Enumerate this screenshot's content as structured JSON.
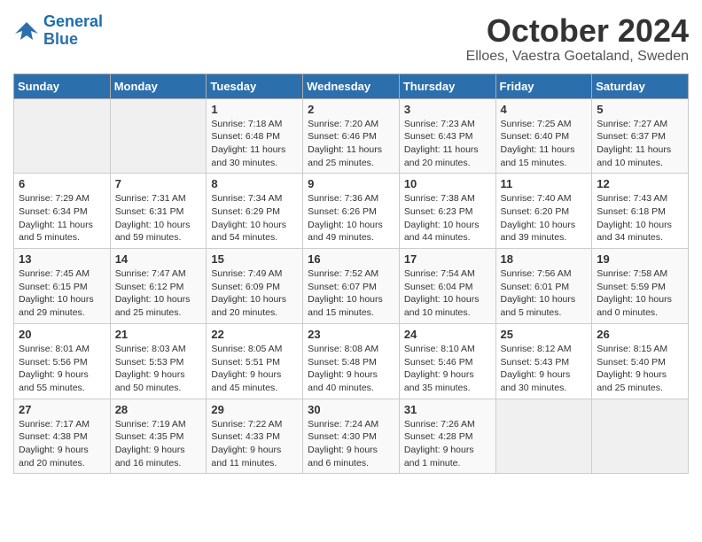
{
  "header": {
    "logo_line1": "General",
    "logo_line2": "Blue",
    "month_title": "October 2024",
    "subtitle": "Elloes, Vaestra Goetaland, Sweden"
  },
  "days_of_week": [
    "Sunday",
    "Monday",
    "Tuesday",
    "Wednesday",
    "Thursday",
    "Friday",
    "Saturday"
  ],
  "weeks": [
    [
      {
        "day": "",
        "info": ""
      },
      {
        "day": "",
        "info": ""
      },
      {
        "day": "1",
        "info": "Sunrise: 7:18 AM\nSunset: 6:48 PM\nDaylight: 11 hours\nand 30 minutes."
      },
      {
        "day": "2",
        "info": "Sunrise: 7:20 AM\nSunset: 6:46 PM\nDaylight: 11 hours\nand 25 minutes."
      },
      {
        "day": "3",
        "info": "Sunrise: 7:23 AM\nSunset: 6:43 PM\nDaylight: 11 hours\nand 20 minutes."
      },
      {
        "day": "4",
        "info": "Sunrise: 7:25 AM\nSunset: 6:40 PM\nDaylight: 11 hours\nand 15 minutes."
      },
      {
        "day": "5",
        "info": "Sunrise: 7:27 AM\nSunset: 6:37 PM\nDaylight: 11 hours\nand 10 minutes."
      }
    ],
    [
      {
        "day": "6",
        "info": "Sunrise: 7:29 AM\nSunset: 6:34 PM\nDaylight: 11 hours\nand 5 minutes."
      },
      {
        "day": "7",
        "info": "Sunrise: 7:31 AM\nSunset: 6:31 PM\nDaylight: 10 hours\nand 59 minutes."
      },
      {
        "day": "8",
        "info": "Sunrise: 7:34 AM\nSunset: 6:29 PM\nDaylight: 10 hours\nand 54 minutes."
      },
      {
        "day": "9",
        "info": "Sunrise: 7:36 AM\nSunset: 6:26 PM\nDaylight: 10 hours\nand 49 minutes."
      },
      {
        "day": "10",
        "info": "Sunrise: 7:38 AM\nSunset: 6:23 PM\nDaylight: 10 hours\nand 44 minutes."
      },
      {
        "day": "11",
        "info": "Sunrise: 7:40 AM\nSunset: 6:20 PM\nDaylight: 10 hours\nand 39 minutes."
      },
      {
        "day": "12",
        "info": "Sunrise: 7:43 AM\nSunset: 6:18 PM\nDaylight: 10 hours\nand 34 minutes."
      }
    ],
    [
      {
        "day": "13",
        "info": "Sunrise: 7:45 AM\nSunset: 6:15 PM\nDaylight: 10 hours\nand 29 minutes."
      },
      {
        "day": "14",
        "info": "Sunrise: 7:47 AM\nSunset: 6:12 PM\nDaylight: 10 hours\nand 25 minutes."
      },
      {
        "day": "15",
        "info": "Sunrise: 7:49 AM\nSunset: 6:09 PM\nDaylight: 10 hours\nand 20 minutes."
      },
      {
        "day": "16",
        "info": "Sunrise: 7:52 AM\nSunset: 6:07 PM\nDaylight: 10 hours\nand 15 minutes."
      },
      {
        "day": "17",
        "info": "Sunrise: 7:54 AM\nSunset: 6:04 PM\nDaylight: 10 hours\nand 10 minutes."
      },
      {
        "day": "18",
        "info": "Sunrise: 7:56 AM\nSunset: 6:01 PM\nDaylight: 10 hours\nand 5 minutes."
      },
      {
        "day": "19",
        "info": "Sunrise: 7:58 AM\nSunset: 5:59 PM\nDaylight: 10 hours\nand 0 minutes."
      }
    ],
    [
      {
        "day": "20",
        "info": "Sunrise: 8:01 AM\nSunset: 5:56 PM\nDaylight: 9 hours\nand 55 minutes."
      },
      {
        "day": "21",
        "info": "Sunrise: 8:03 AM\nSunset: 5:53 PM\nDaylight: 9 hours\nand 50 minutes."
      },
      {
        "day": "22",
        "info": "Sunrise: 8:05 AM\nSunset: 5:51 PM\nDaylight: 9 hours\nand 45 minutes."
      },
      {
        "day": "23",
        "info": "Sunrise: 8:08 AM\nSunset: 5:48 PM\nDaylight: 9 hours\nand 40 minutes."
      },
      {
        "day": "24",
        "info": "Sunrise: 8:10 AM\nSunset: 5:46 PM\nDaylight: 9 hours\nand 35 minutes."
      },
      {
        "day": "25",
        "info": "Sunrise: 8:12 AM\nSunset: 5:43 PM\nDaylight: 9 hours\nand 30 minutes."
      },
      {
        "day": "26",
        "info": "Sunrise: 8:15 AM\nSunset: 5:40 PM\nDaylight: 9 hours\nand 25 minutes."
      }
    ],
    [
      {
        "day": "27",
        "info": "Sunrise: 7:17 AM\nSunset: 4:38 PM\nDaylight: 9 hours\nand 20 minutes."
      },
      {
        "day": "28",
        "info": "Sunrise: 7:19 AM\nSunset: 4:35 PM\nDaylight: 9 hours\nand 16 minutes."
      },
      {
        "day": "29",
        "info": "Sunrise: 7:22 AM\nSunset: 4:33 PM\nDaylight: 9 hours\nand 11 minutes."
      },
      {
        "day": "30",
        "info": "Sunrise: 7:24 AM\nSunset: 4:30 PM\nDaylight: 9 hours\nand 6 minutes."
      },
      {
        "day": "31",
        "info": "Sunrise: 7:26 AM\nSunset: 4:28 PM\nDaylight: 9 hours\nand 1 minute."
      },
      {
        "day": "",
        "info": ""
      },
      {
        "day": "",
        "info": ""
      }
    ]
  ]
}
